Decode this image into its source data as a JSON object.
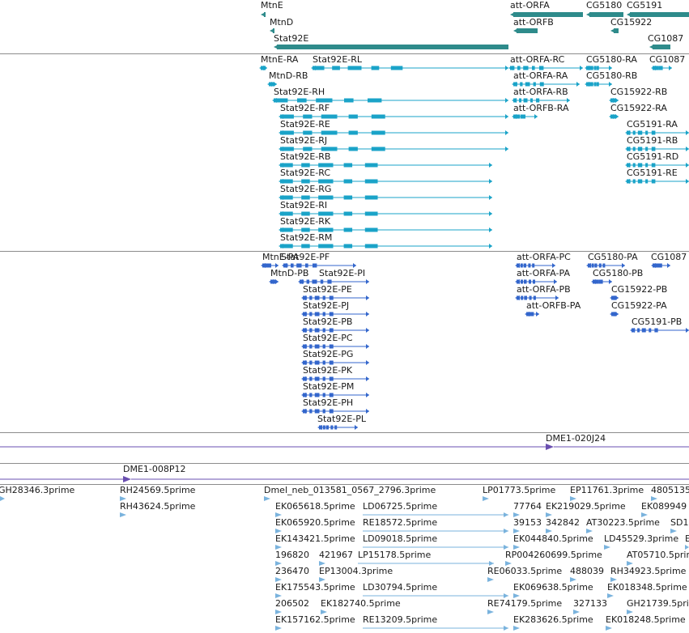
{
  "tracks": [
    {
      "id": "gene-track",
      "color": "#2e8b8b",
      "features": [
        {
          "label": "MtnE"
        },
        {
          "label": "MtnD"
        },
        {
          "label": "Stat92E"
        },
        {
          "label": "att-ORFA"
        },
        {
          "label": "att-ORFB"
        },
        {
          "label": "CG5180"
        },
        {
          "label": "CG5191"
        },
        {
          "label": "CG15922"
        },
        {
          "label": "CG1087"
        }
      ]
    },
    {
      "id": "transcript-track",
      "color": "#1aa3c8",
      "features": [
        {
          "label": "MtnE-RA"
        },
        {
          "label": "Stat92E-RL"
        },
        {
          "label": "att-ORFA-RC"
        },
        {
          "label": "CG5180-RA"
        },
        {
          "label": "CG1087"
        },
        {
          "label": "MtnD-RB"
        },
        {
          "label": "att-ORFA-RA"
        },
        {
          "label": "CG5180-RB"
        },
        {
          "label": "Stat92E-RH"
        },
        {
          "label": "att-ORFA-RB"
        },
        {
          "label": "CG15922-RB"
        },
        {
          "label": "Stat92E-RF"
        },
        {
          "label": "att-ORFB-RA"
        },
        {
          "label": "CG15922-RA"
        },
        {
          "label": "Stat92E-RE"
        },
        {
          "label": "CG5191-RA"
        },
        {
          "label": "Stat92E-RJ"
        },
        {
          "label": "CG5191-RB"
        },
        {
          "label": "Stat92E-RB"
        },
        {
          "label": "CG5191-RD"
        },
        {
          "label": "Stat92E-RC"
        },
        {
          "label": "CG5191-RE"
        },
        {
          "label": "Stat92E-RG"
        },
        {
          "label": "Stat92E-RI"
        },
        {
          "label": "Stat92E-RK"
        },
        {
          "label": "Stat92E-RM"
        }
      ]
    },
    {
      "id": "protein-track",
      "color": "#3366cc",
      "features": [
        {
          "label": "MtnE-PA"
        },
        {
          "label": "Stat92E-PF"
        },
        {
          "label": "att-ORFA-PC"
        },
        {
          "label": "CG5180-PA"
        },
        {
          "label": "CG1087"
        },
        {
          "label": "MtnD-PB"
        },
        {
          "label": "Stat92E-PI"
        },
        {
          "label": "att-ORFA-PA"
        },
        {
          "label": "CG5180-PB"
        },
        {
          "label": "Stat92E-PE"
        },
        {
          "label": "att-ORFA-PB"
        },
        {
          "label": "CG15922-PB"
        },
        {
          "label": "Stat92E-PJ"
        },
        {
          "label": "att-ORFB-PA"
        },
        {
          "label": "CG15922-PA"
        },
        {
          "label": "Stat92E-PB"
        },
        {
          "label": "CG5191-PB"
        },
        {
          "label": "Stat92E-PC"
        },
        {
          "label": "Stat92E-PG"
        },
        {
          "label": "Stat92E-PK"
        },
        {
          "label": "Stat92E-PM"
        },
        {
          "label": "Stat92E-PH"
        },
        {
          "label": "Stat92E-PL"
        }
      ]
    },
    {
      "id": "bac-track-1",
      "color": "#6a4fb0",
      "features": [
        {
          "label": "DME1-020J24"
        }
      ]
    },
    {
      "id": "bac-track-2",
      "color": "#6a4fb0",
      "features": [
        {
          "label": "DME1-008P12"
        }
      ]
    },
    {
      "id": "est-track",
      "color": "#7ab3dd",
      "features": [
        {
          "label": "GH28346.3prime"
        },
        {
          "label": "RH24569.5prime"
        },
        {
          "label": "Dmel_neb_013581_0567_2796.3prime"
        },
        {
          "label": "LP01773.5prime"
        },
        {
          "label": "EP11761.3prime"
        },
        {
          "label": "4805135"
        },
        {
          "label": "RH43624.5prime"
        },
        {
          "label": "EK065618.5prime"
        },
        {
          "label": "LD06725.5prime"
        },
        {
          "label": "77764"
        },
        {
          "label": "EK219029.5prime"
        },
        {
          "label": "EK089949"
        },
        {
          "label": "EK065920.5prime"
        },
        {
          "label": "RE18572.5prime"
        },
        {
          "label": "39153"
        },
        {
          "label": "342842"
        },
        {
          "label": "AT30223.5prime"
        },
        {
          "label": "SD1"
        },
        {
          "label": "EK143421.5prime"
        },
        {
          "label": "LD09018.5prime"
        },
        {
          "label": "EK044840.5prime"
        },
        {
          "label": "LD45529.3prime"
        },
        {
          "label": "E"
        },
        {
          "label": "196820"
        },
        {
          "label": "421967"
        },
        {
          "label": "LP15178.5prime"
        },
        {
          "label": "RP004260699.5prime"
        },
        {
          "label": "AT05710.5prime"
        },
        {
          "label": "236470"
        },
        {
          "label": "EP13004.3prime"
        },
        {
          "label": "RE06033.5prime"
        },
        {
          "label": "488039"
        },
        {
          "label": "RH34923.5prime"
        },
        {
          "label": "EK175543.5prime"
        },
        {
          "label": "LD30794.5prime"
        },
        {
          "label": "EK069638.5prime"
        },
        {
          "label": "EK018348.5prime"
        },
        {
          "label": "206502"
        },
        {
          "label": "EK182740.5prime"
        },
        {
          "label": "RE74179.5prime"
        },
        {
          "label": "327133"
        },
        {
          "label": "GH21739.5prime"
        },
        {
          "label": "EK157162.5prime"
        },
        {
          "label": "RE13209.5prime"
        },
        {
          "label": "EK283626.5prime"
        },
        {
          "label": "EK018248.5prime"
        }
      ]
    }
  ]
}
